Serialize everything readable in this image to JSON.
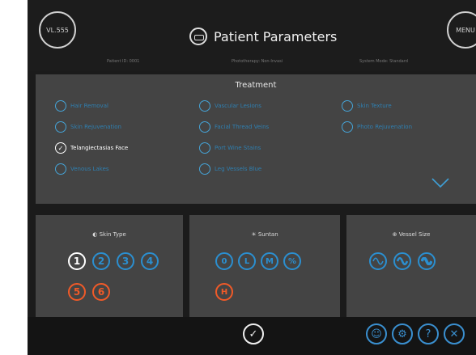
{
  "header": {
    "left_button": "VL.555",
    "right_button": "MENU",
    "title": "Patient Parameters",
    "info": [
      "Patient ID: 0001",
      "Phototherapy: Non-Invasi",
      "System Mode: Standard"
    ]
  },
  "treatment": {
    "title": "Treatment",
    "options": [
      {
        "label": "Hair Removal",
        "checked": false
      },
      {
        "label": "Skin Rejuvenation",
        "checked": false
      },
      {
        "label": "Telangiectasias Face",
        "checked": true
      },
      {
        "label": "Venous Lakes",
        "checked": false
      },
      {
        "label": "Vascular Lesions",
        "checked": false
      },
      {
        "label": "Facial Thread Veins",
        "checked": false
      },
      {
        "label": "Port Wine Stains",
        "checked": false
      },
      {
        "label": "Leg Vessels Blue",
        "checked": false
      },
      {
        "label": "Skin Texture",
        "checked": false
      },
      {
        "label": "Photo Rejuvenation",
        "checked": false
      }
    ]
  },
  "skin_type": {
    "title": "Skin Type",
    "values": [
      "1",
      "2",
      "3",
      "4",
      "5",
      "6"
    ]
  },
  "suntan": {
    "title": "Suntan",
    "values": [
      "0",
      "L",
      "M",
      "%",
      "H"
    ]
  },
  "vessel_size": {
    "title": "Vessel Size",
    "values": [
      "~",
      "~",
      "~"
    ]
  },
  "footer": {
    "confirm_icon": "check-icon",
    "buttons": [
      "user-icon",
      "settings-icon",
      "help-icon",
      "close-icon"
    ]
  }
}
